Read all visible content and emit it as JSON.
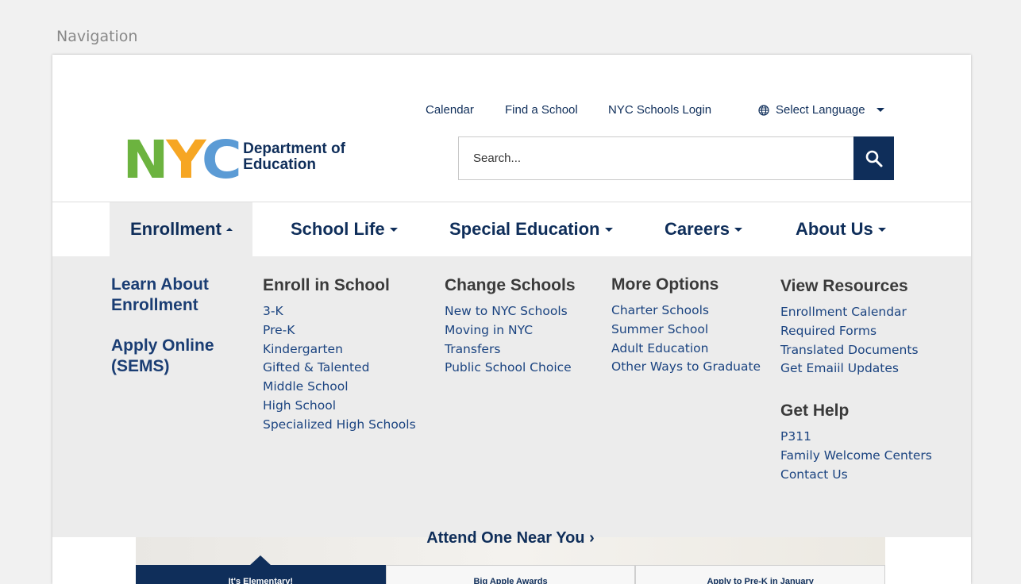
{
  "frame_label": "Navigation",
  "utility_nav": {
    "calendar": "Calendar",
    "find_school": "Find a School",
    "login": "NYC Schools Login",
    "language": "Select Language"
  },
  "logo": {
    "mark_n": "N",
    "mark_y": "Y",
    "mark_c": "C",
    "line1": "Department of",
    "line2": "Education"
  },
  "search": {
    "placeholder": "Search..."
  },
  "main_nav": {
    "enrollment": "Enrollment",
    "school_life": "School Life",
    "special_education": "Special Education",
    "careers": "Careers",
    "about_us": "About Us"
  },
  "mega_menu": {
    "learn_about": [
      "Learn About",
      "Enrollment"
    ],
    "apply_online": [
      "Apply Online",
      "(SEMS)"
    ],
    "enroll": {
      "heading": "Enroll in School",
      "items": [
        "3-K",
        "Pre-K",
        "Kindergarten",
        "Gifted & Talented",
        "Middle School",
        "High School",
        "Specialized High Schools"
      ]
    },
    "change": {
      "heading": "Change Schools",
      "items": [
        "New to NYC Schools",
        "Moving in NYC",
        "Transfers",
        "Public School Choice"
      ]
    },
    "more": {
      "heading": "More Options",
      "items": [
        "Charter Schools",
        "Summer School",
        "Adult Education",
        "Other Ways to Graduate"
      ]
    },
    "resources": {
      "heading": "View Resources",
      "items": [
        "Enrollment Calendar",
        "Required Forms",
        "Translated Documents",
        "Get Emaiil Updates"
      ]
    },
    "help": {
      "heading": "Get Help",
      "items": [
        "P311",
        "Family Welcome Centers",
        "Contact Us"
      ]
    }
  },
  "below": {
    "partial_text": "Attend One Near You ›",
    "tabs": [
      "It's Elementary!",
      "Big Apple Awards",
      "Apply to Pre-K in January"
    ]
  },
  "colors": {
    "navy": "#0f2e5a",
    "panel": "#ececec",
    "link": "#1a4380"
  }
}
